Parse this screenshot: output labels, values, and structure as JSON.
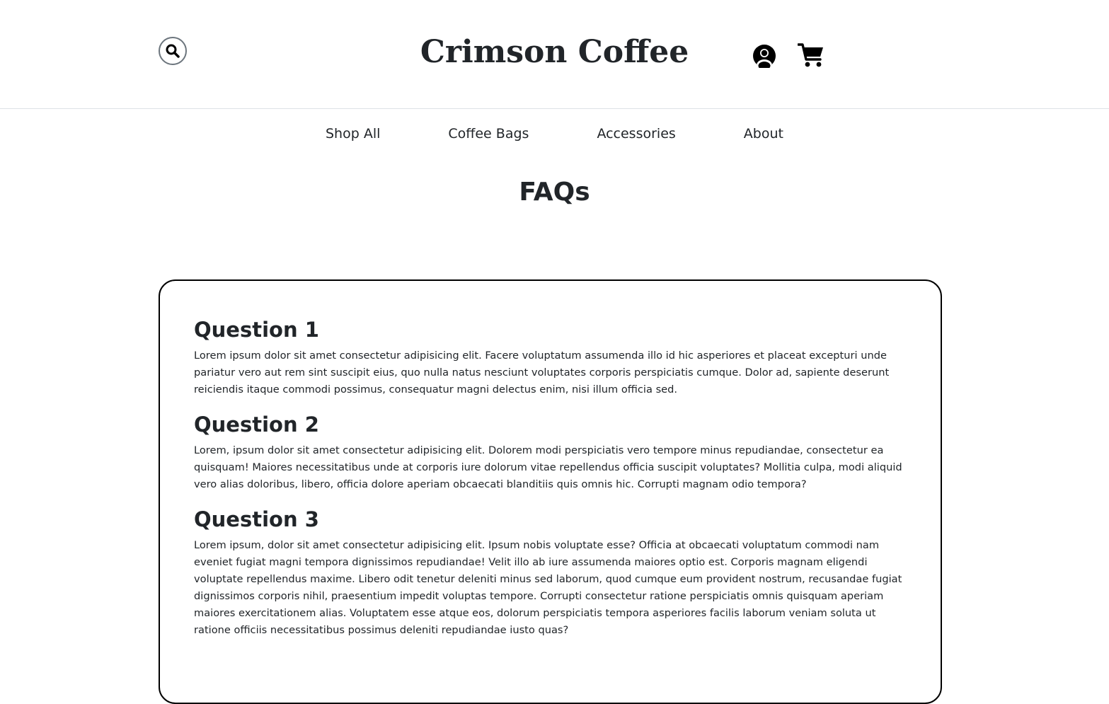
{
  "header": {
    "brand": "Crimson Coffee",
    "search_icon": "search-icon",
    "account_icon": "user-circle-icon",
    "cart_icon": "shopping-cart-icon"
  },
  "nav": {
    "items": [
      {
        "label": "Shop All"
      },
      {
        "label": "Coffee Bags"
      },
      {
        "label": "Accessories"
      },
      {
        "label": "About"
      }
    ]
  },
  "page": {
    "title": "FAQs"
  },
  "faqs": [
    {
      "question": "Question 1",
      "answer": "Lorem ipsum dolor sit amet consectetur adipisicing elit. Facere voluptatum assumenda illo id hic asperiores et placeat excepturi unde pariatur vero aut rem sint suscipit eius, quo nulla natus nesciunt voluptates corporis perspiciatis cumque. Dolor ad, sapiente deserunt reiciendis itaque commodi possimus, consequatur magni delectus enim, nisi illum officia sed."
    },
    {
      "question": "Question 2",
      "answer": "Lorem, ipsum dolor sit amet consectetur adipisicing elit. Dolorem modi perspiciatis vero tempore minus repudiandae, consectetur ea quisquam! Maiores necessitatibus unde at corporis iure dolorum vitae repellendus officia suscipit voluptates? Mollitia culpa, modi aliquid vero alias doloribus, libero, officia dolore aperiam obcaecati blanditiis quis omnis hic. Corrupti magnam odio tempora?"
    },
    {
      "question": "Question 3",
      "answer": "Lorem ipsum, dolor sit amet consectetur adipisicing elit. Ipsum nobis voluptate esse? Officia at obcaecati voluptatum commodi nam eveniet fugiat magni tempora dignissimos repudiandae! Velit illo ab iure assumenda maiores optio est. Corporis magnam eligendi voluptate repellendus maxime. Libero odit tenetur deleniti minus sed laborum, quod cumque eum provident nostrum, recusandae fugiat dignissimos corporis nihil, praesentium impedit voluptas tempore. Corrupti consectetur ratione perspiciatis omnis quisquam aperiam maiores exercitationem alias. Voluptatem esse atque eos, dolorum perspiciatis tempora asperiores facilis laborum veniam soluta ut ratione officiis necessitatibus possimus deleniti repudiandae iusto quas?"
    }
  ]
}
